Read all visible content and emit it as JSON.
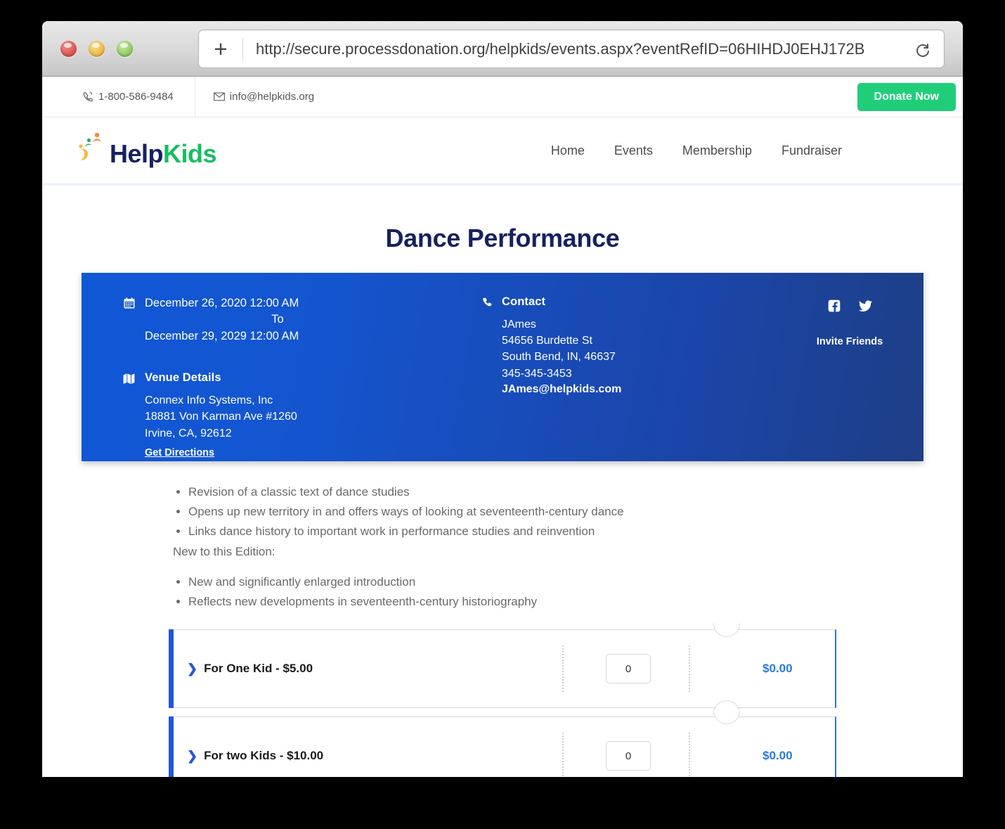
{
  "browser": {
    "url": "http://secure.processdonation.org/helpkids/events.aspx?eventRefID=06HIHDJ0EHJ172B",
    "new_tab_label": "+",
    "reload_icon": "reload-icon"
  },
  "topbar": {
    "phone_icon": "phone-icon",
    "phone": "1-800-586-9484",
    "email_icon": "envelope-icon",
    "email": "info@helpkids.org",
    "donate_label": "Donate Now",
    "donate_color": "#20ce79"
  },
  "header": {
    "logo": {
      "part1": "Help",
      "part2": "Kids",
      "part1_color": "#17215e",
      "part2_color": "#17bd62"
    },
    "nav": [
      {
        "label": "Home"
      },
      {
        "label": "Events"
      },
      {
        "label": "Membership"
      },
      {
        "label": "Fundraiser"
      }
    ]
  },
  "page": {
    "title": "Dance Performance",
    "title_color": "#17215e"
  },
  "info_panel": {
    "calendar_icon": "calendar-icon",
    "date_start": "December 26, 2020 12:00 AM",
    "date_separator": "To",
    "date_end": "December 29, 2029 12:00 AM",
    "venue_icon": "map-icon",
    "venue_heading": "Venue Details",
    "venue_lines": [
      "Connex Info Systems, Inc",
      "18881 Von Karman Ave #1260",
      "Irvine, CA, 92612"
    ],
    "get_directions": "Get Directions",
    "contact_icon": "phone-handset-icon",
    "contact_heading": "Contact",
    "contact_lines": [
      "JAmes",
      "54656 Burdette St",
      "South Bend, IN, 46637",
      "345-345-3453"
    ],
    "contact_email": "JAmes@helpkids.com",
    "social": {
      "facebook_icon": "facebook-icon",
      "twitter_icon": "twitter-icon",
      "invite_label": "Invite Friends"
    },
    "gradient_from": "#1057d6",
    "gradient_to": "#1e3f85"
  },
  "description": {
    "bullets_top": [
      "Revision of a classic text of dance studies",
      "Opens up new territory in and offers ways of looking at seventeenth-century dance",
      "Links dance history to important work in performance studies and reinvention"
    ],
    "note": "New to this Edition:",
    "bullets_bottom": [
      "New and significantly enlarged introduction",
      "Reflects new developments in seventeenth-century historiography"
    ]
  },
  "tickets": [
    {
      "chevron_icon": "chevron-right-icon",
      "label": "For One Kid - $5.00",
      "quantity": "0",
      "amount": "$0.00"
    },
    {
      "chevron_icon": "chevron-right-icon",
      "label": "For two Kids - $10.00",
      "quantity": "0",
      "amount": "$0.00"
    }
  ]
}
